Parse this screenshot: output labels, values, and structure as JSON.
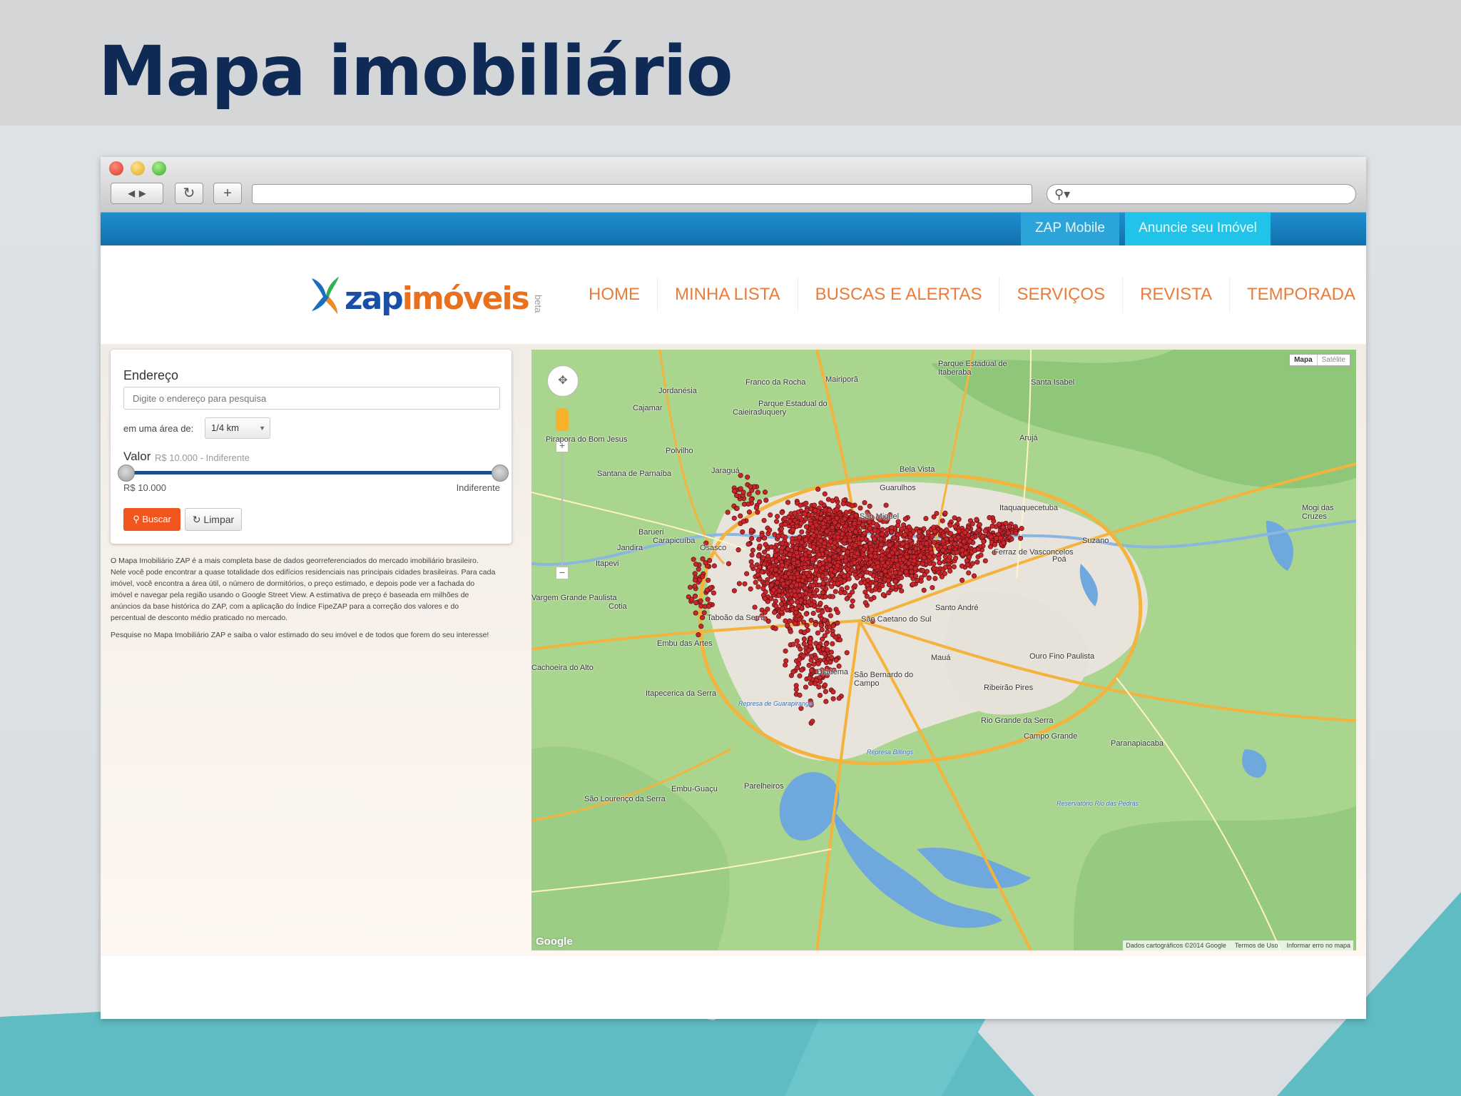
{
  "slide": {
    "title": "Mapa imobiliário"
  },
  "browser": {
    "nav": {
      "back_forward": "◂ ▸",
      "reload": "↻",
      "new_tab": "+"
    },
    "search_icon": "search-icon"
  },
  "site": {
    "topbar": {
      "mobile": "ZAP Mobile",
      "anuncie": "Anuncie seu Imóvel"
    },
    "logo": {
      "zap": "zap",
      "imoveis": "imóveis",
      "beta": "beta"
    },
    "nav": [
      "HOME",
      "MINHA LISTA",
      "BUSCAS E ALERTAS",
      "SERVIÇOS",
      "REVISTA",
      "TEMPORADA"
    ],
    "search": {
      "endereco_label": "Endereço",
      "endereco_placeholder": "Digite o endereço para pesquisa",
      "area_label": "em uma área de:",
      "area_value": "1/4 km",
      "valor_label": "Valor",
      "valor_range": "R$ 10.000 - Indiferente",
      "slider_min": "R$ 10.000",
      "slider_max": "Indiferente",
      "buscar": "Buscar",
      "limpar": "Limpar"
    },
    "description": [
      "O Mapa Imobiliário ZAP é a mais completa base de dados georreferenciados do mercado imobiliário brasileiro. Nele você pode encontrar a quase totalidade dos edifícios residenciais nas principais cidades brasileiras. Para cada imóvel, você encontra a área útil, o número de dormitórios, o preço estimado, e depois pode ver a fachada do imóvel e navegar pela região usando o Google Street View. A estimativa de preço é baseada em milhões de anúncios da base histórica do ZAP, com a aplicação do Índice FipeZAP para a correção dos valores e do percentual de desconto médio praticado no mercado.",
      "Pesquise no Mapa Imobiliário ZAP e saiba o valor estimado do seu imóvel e de todos que forem do seu interesse!"
    ]
  },
  "map": {
    "type_toggle": [
      "Mapa",
      "Satélite"
    ],
    "places": [
      "Franco da Rocha",
      "Mairiporã",
      "Caieiras",
      "Parque Estadual do Juquery",
      "Cajamar",
      "Jordanésia",
      "Polvilho",
      "Jaraguá",
      "Pirapora do Bom Jesus",
      "Santana de Parnaíba",
      "Barueri",
      "Carapicuíba",
      "Jandira",
      "Osasco",
      "Itapevi",
      "Cotia",
      "Taboão da Serra",
      "Embu das Artes",
      "Itapecerica da Serra",
      "Embu-Guaçu",
      "Diadema",
      "São Caetano do Sul",
      "São Bernardo do Campo",
      "Santo André",
      "Mauá",
      "Ribeirão Pires",
      "Rio Grande da Serra",
      "Guarulhos",
      "Bela Vista",
      "Arujá",
      "Itaquaquecetuba",
      "Ferraz de Vasconcelos",
      "Poá",
      "Suzano",
      "Mogi das Cruzes",
      "Santa Isabel",
      "Parque Estadual de Itaberaba",
      "São Miguel",
      "Vargem Grande Paulista",
      "Parelheiros",
      "São Lourenço da Serra",
      "Cachoeira do Alto",
      "Ouro Fino Paulista",
      "Campo Grande",
      "Paranapiacaba",
      "Represa de Guarapiranga",
      "Represa Billings",
      "Reservatório Rio das Pedras"
    ],
    "attribution": [
      "Dados cartográficos ©2014 Google",
      "Termos de Uso",
      "Informar erro no mapa"
    ],
    "google": "Google",
    "marker_color": "#c8262b"
  }
}
